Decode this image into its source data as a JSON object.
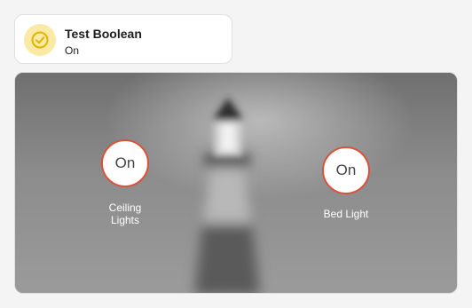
{
  "entity_tile": {
    "title": "Test Boolean",
    "state": "On",
    "icon": "check-circle-icon",
    "icon_color": "#e0b400",
    "icon_background": "#fbeaa5"
  },
  "picture_elements": {
    "background": "blurred-lighthouse-photo",
    "accent_color": "#d9533b",
    "elements": [
      {
        "state": "On",
        "label_line1": "Ceiling",
        "label_line2": "Lights"
      },
      {
        "state": "On",
        "label_line1": "Bed Light",
        "label_line2": ""
      }
    ]
  }
}
